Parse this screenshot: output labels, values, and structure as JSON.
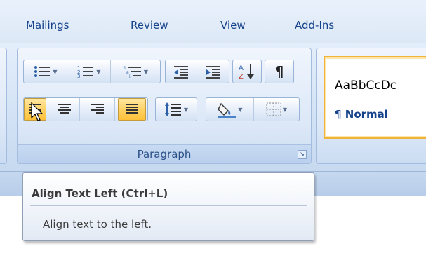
{
  "tabs": [
    {
      "label": "Mailings"
    },
    {
      "label": "Review"
    },
    {
      "label": "View"
    },
    {
      "label": "Add-Ins"
    }
  ],
  "paragraph_group": {
    "label": "Paragraph",
    "row1": [
      "bullets",
      "numbering",
      "multilevel-list",
      "decrease-indent",
      "increase-indent",
      "sort",
      "show-hide"
    ],
    "row2": [
      "align-left",
      "center",
      "align-right",
      "justify",
      "line-spacing",
      "shading",
      "borders"
    ],
    "active_button": "align-left"
  },
  "styles": {
    "sample_text": "AaBbCcDc",
    "name": "¶ Normal"
  },
  "tooltip": {
    "title": "Align Text Left (Ctrl+L)",
    "description": "Align text to the left."
  },
  "colors": {
    "accent_text": "#15428b",
    "active_highlight": "#ffd060"
  }
}
